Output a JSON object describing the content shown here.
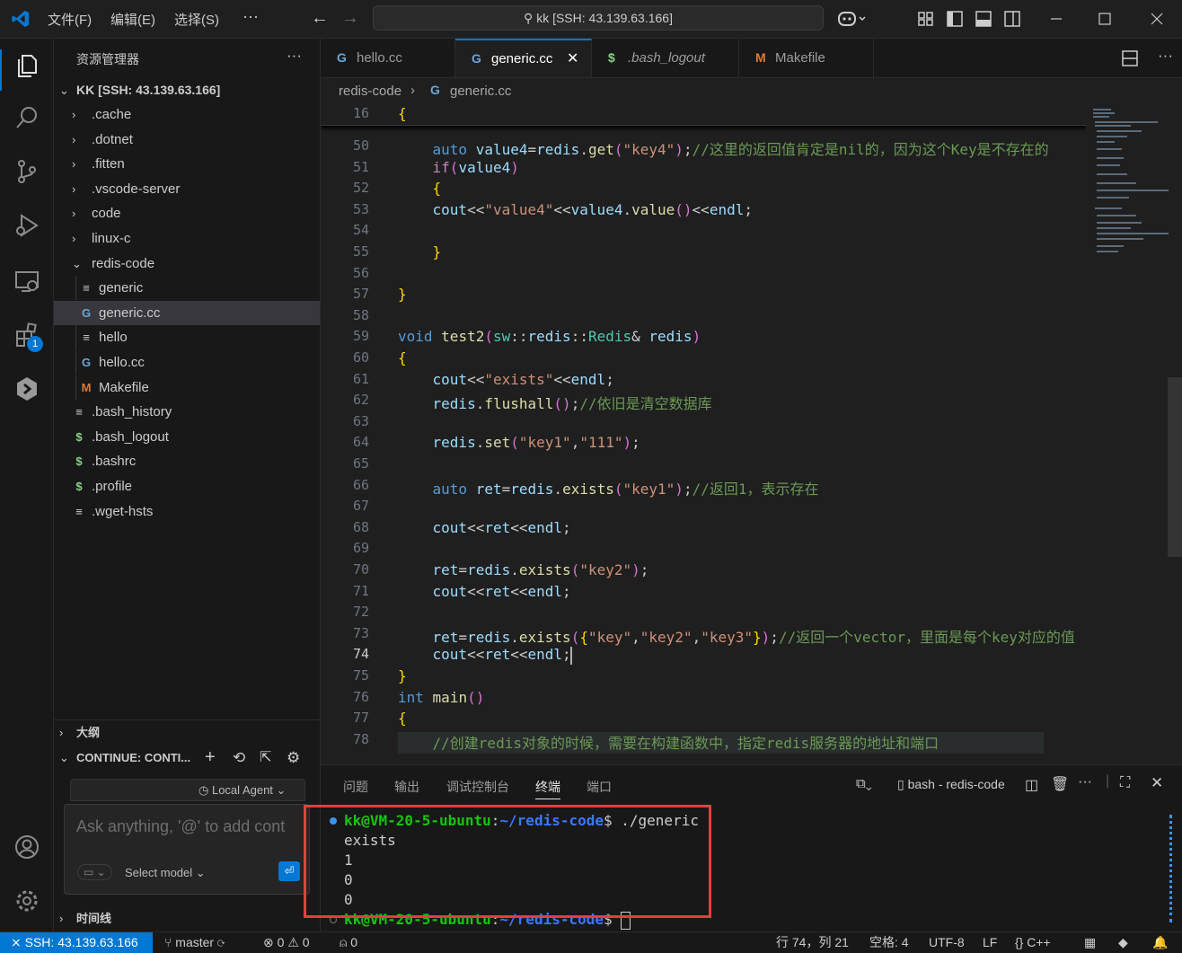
{
  "window": {
    "menu": [
      "文件(F)",
      "编辑(E)",
      "选择(S)"
    ],
    "more": "···",
    "search_text": "kk [SSH: 43.139.63.166]"
  },
  "activity": {
    "extensions_badge": "1"
  },
  "explorer": {
    "title": "资源管理器",
    "more": "···",
    "root": "KK [SSH: 43.139.63.166]",
    "items": [
      {
        "label": ".cache",
        "type": "folder",
        "icon": "chevron-right-icon"
      },
      {
        "label": ".dotnet",
        "type": "folder",
        "icon": "chevron-right-icon"
      },
      {
        "label": ".fitten",
        "type": "folder",
        "icon": "chevron-right-icon"
      },
      {
        "label": ".vscode-server",
        "type": "folder",
        "icon": "chevron-right-icon"
      },
      {
        "label": "code",
        "type": "folder",
        "icon": "chevron-right-icon"
      },
      {
        "label": "linux-c",
        "type": "folder",
        "icon": "chevron-right-icon"
      },
      {
        "label": "redis-code",
        "type": "folder-open",
        "icon": "chevron-down-icon"
      },
      {
        "label": "generic",
        "type": "file",
        "icon": "text-file-icon"
      },
      {
        "label": "generic.cc",
        "type": "file",
        "icon": "cpp-file-icon"
      },
      {
        "label": "hello",
        "type": "file",
        "icon": "text-file-icon"
      },
      {
        "label": "hello.cc",
        "type": "file",
        "icon": "cpp-file-icon"
      },
      {
        "label": "Makefile",
        "type": "file",
        "icon": "makefile-icon"
      },
      {
        "label": ".bash_history",
        "type": "file",
        "icon": "text-file-icon"
      },
      {
        "label": ".bash_logout",
        "type": "file",
        "icon": "shell-file-icon"
      },
      {
        "label": ".bashrc",
        "type": "file",
        "icon": "shell-file-icon"
      },
      {
        "label": ".profile",
        "type": "file",
        "icon": "shell-file-icon"
      },
      {
        "label": ".wget-hsts",
        "type": "file",
        "icon": "text-file-icon"
      }
    ],
    "outline": "大纲",
    "continue_section": "CONTINUE: CONTI...",
    "timeline": "时间线"
  },
  "chat": {
    "local_agent": "Local Agent",
    "placeholder": "Ask anything, '@' to add cont",
    "select_model": "Select model"
  },
  "tabs": [
    {
      "label": "hello.cc",
      "icon": "cpp-file-icon",
      "active": false
    },
    {
      "label": "generic.cc",
      "icon": "cpp-file-icon",
      "active": true
    },
    {
      "label": ".bash_logout",
      "icon": "shell-file-icon",
      "active": false
    },
    {
      "label": "Makefile",
      "icon": "makefile-icon",
      "active": false
    }
  ],
  "breadcrumb": {
    "folder": "redis-code",
    "file": "generic.cc"
  },
  "code": {
    "sticky_line": "16",
    "current_line": "74",
    "lines": [
      {
        "n": "50",
        "text": "    auto value4=redis.get(\"key4\");//这里的返回值肯定是nil的，因为这个Key是不存在的"
      },
      {
        "n": "51",
        "text": "    if(value4)"
      },
      {
        "n": "52",
        "text": "    {"
      },
      {
        "n": "53",
        "text": "    cout<<\"value4\"<<value4.value()<<endl;"
      },
      {
        "n": "54",
        "text": ""
      },
      {
        "n": "55",
        "text": "    }"
      },
      {
        "n": "56",
        "text": ""
      },
      {
        "n": "57",
        "text": "}"
      },
      {
        "n": "58",
        "text": ""
      },
      {
        "n": "59",
        "text": "void test2(sw::redis::Redis& redis)"
      },
      {
        "n": "60",
        "text": "{"
      },
      {
        "n": "61",
        "text": "    cout<<\"exists\"<<endl;"
      },
      {
        "n": "62",
        "text": "    redis.flushall();//依旧是清空数据库"
      },
      {
        "n": "63",
        "text": ""
      },
      {
        "n": "64",
        "text": "    redis.set(\"key1\",\"111\");"
      },
      {
        "n": "65",
        "text": ""
      },
      {
        "n": "66",
        "text": "    auto ret=redis.exists(\"key1\");//返回1，表示存在"
      },
      {
        "n": "67",
        "text": ""
      },
      {
        "n": "68",
        "text": "    cout<<ret<<endl;"
      },
      {
        "n": "69",
        "text": ""
      },
      {
        "n": "70",
        "text": "    ret=redis.exists(\"key2\");"
      },
      {
        "n": "71",
        "text": "    cout<<ret<<endl;"
      },
      {
        "n": "72",
        "text": ""
      },
      {
        "n": "73",
        "text": "    ret=redis.exists({\"key\",\"key2\",\"key3\"});//返回一个vector，里面是每个key对应的值"
      },
      {
        "n": "74",
        "text": "    cout<<ret<<endl;"
      },
      {
        "n": "75",
        "text": "}"
      },
      {
        "n": "76",
        "text": "int main()"
      },
      {
        "n": "77",
        "text": "{"
      },
      {
        "n": "78",
        "text": "    //创建redis对象的时候，需要在构建函数中，指定redis服务器的地址和端口"
      }
    ]
  },
  "panel": {
    "tabs": [
      "问题",
      "输出",
      "调试控制台",
      "终端",
      "端口"
    ],
    "active_tab": "终端",
    "terminal_name": "bash - redis-code",
    "more": "···",
    "prompt_user": "kk@VM-20-5-ubuntu",
    "prompt_path": "~/redis-code",
    "command": "./generic",
    "output": [
      "exists",
      "1",
      "0",
      "0"
    ]
  },
  "status": {
    "remote": "SSH: 43.139.63.166",
    "branch": "master",
    "errors": "0",
    "warnings": "0",
    "ports": "0",
    "position": "行 74，列 21",
    "spaces": "空格: 4",
    "encoding": "UTF-8",
    "eol": "LF",
    "language": "C++"
  },
  "colors": {
    "accent": "#0078d4",
    "highlight_box": "#e04040"
  }
}
